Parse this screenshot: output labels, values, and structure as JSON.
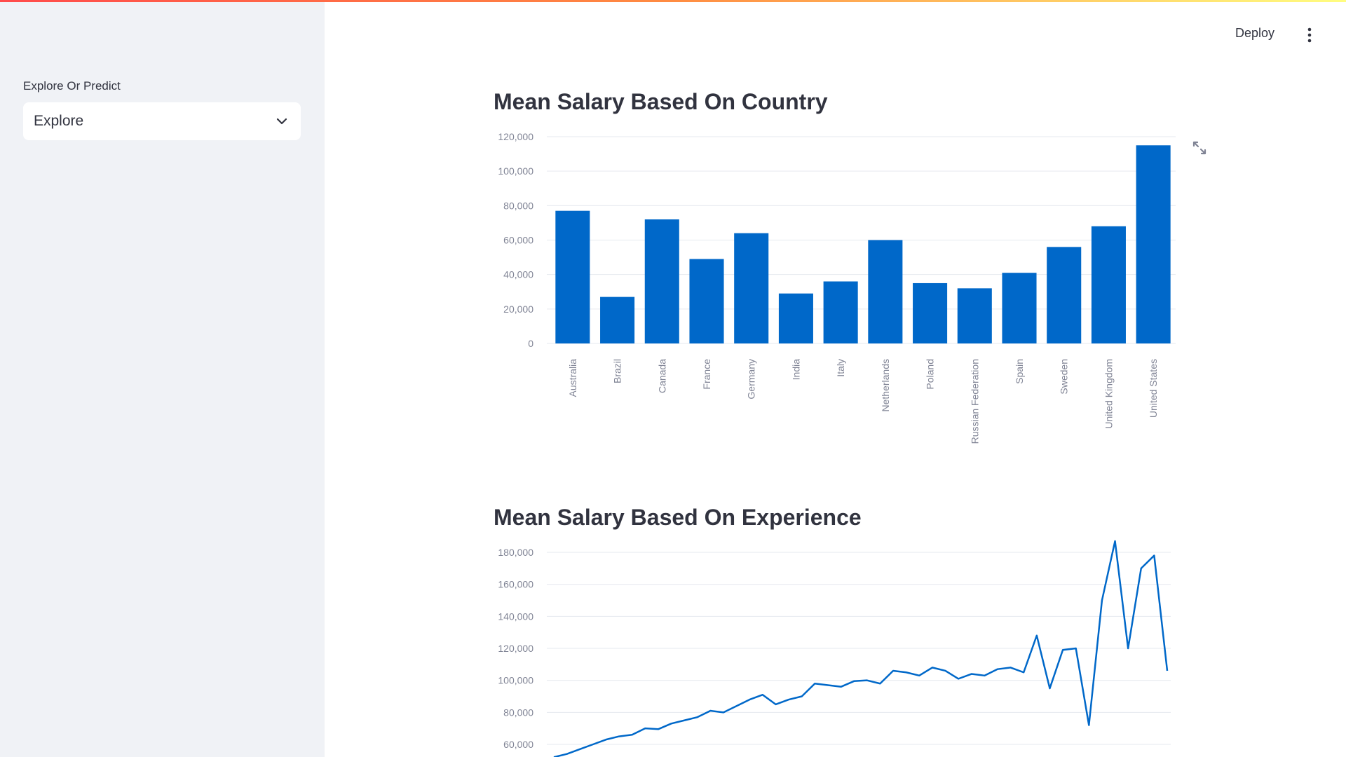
{
  "header": {
    "deploy_label": "Deploy",
    "menu_icon": "more-vert-icon"
  },
  "sidebar": {
    "select_label": "Explore Or Predict",
    "select_value": "Explore"
  },
  "main": {
    "country_title": "Mean Salary Based On Country",
    "experience_title": "Mean Salary Based On Experience"
  },
  "colors": {
    "bar": "#0068c9",
    "line": "#0068c9",
    "grid": "#e6e9ef",
    "tick": "#808495"
  },
  "chart_data": [
    {
      "type": "bar",
      "title": "Mean Salary Based On Country",
      "categories": [
        "Australia",
        "Brazil",
        "Canada",
        "France",
        "Germany",
        "India",
        "Italy",
        "Netherlands",
        "Poland",
        "Russian Federation",
        "Spain",
        "Sweden",
        "United Kingdom",
        "United States"
      ],
      "values": [
        77000,
        27000,
        72000,
        49000,
        64000,
        29000,
        36000,
        60000,
        35000,
        32000,
        41000,
        56000,
        68000,
        115000
      ],
      "ylim": [
        0,
        120000
      ],
      "yticks": [
        0,
        20000,
        40000,
        60000,
        80000,
        100000,
        120000
      ],
      "ytick_labels": [
        "0",
        "20,000",
        "40,000",
        "60,000",
        "80,000",
        "100,000",
        "120,000"
      ],
      "grid": true
    },
    {
      "type": "line",
      "title": "Mean Salary Based On Experience",
      "values": [
        52000,
        54000,
        57000,
        60000,
        63000,
        65000,
        66000,
        70000,
        69500,
        73000,
        75000,
        77000,
        81000,
        80000,
        84000,
        88000,
        91000,
        85000,
        88000,
        90000,
        98000,
        97000,
        96000,
        99500,
        100000,
        98000,
        106000,
        105000,
        103000,
        108000,
        106000,
        101000,
        104000,
        103000,
        107000,
        108000,
        105000,
        128000,
        95000,
        119000,
        120000,
        72000,
        150000,
        187000,
        120000,
        170000,
        178000,
        106000
      ],
      "ylim": [
        60000,
        180000
      ],
      "yticks": [
        60000,
        80000,
        100000,
        120000,
        140000,
        160000,
        180000
      ],
      "ytick_labels": [
        "60,000",
        "80,000",
        "100,000",
        "120,000",
        "140,000",
        "160,000",
        "180,000"
      ],
      "grid": true
    }
  ]
}
